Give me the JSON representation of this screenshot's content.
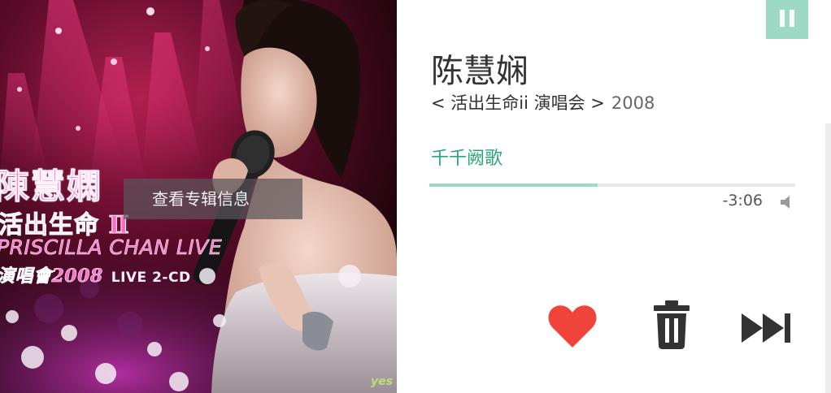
{
  "cover": {
    "artist_text": "陳慧嫻",
    "subtitle_text": "活出生命 Ⅱ",
    "english_text": "PRISCILLA CHAN LIVE",
    "year_text": "演唱會2008",
    "live_text": "LIVE 2-CD",
    "watermark": "yes",
    "album_info_button_label": "查看专辑信息"
  },
  "player": {
    "artist": "陈慧娴",
    "album": "< 活出生命ii 演唱会 >",
    "year": "2008",
    "song": "千千阙歌",
    "time_remaining": "-3:06",
    "progress_fraction": 0.46,
    "is_playing": true
  },
  "controls": {
    "pause_icon": "pause-icon",
    "like_icon": "heart-icon",
    "delete_icon": "trash-icon",
    "next_icon": "skip-next-icon",
    "volume_icon": "volume-icon"
  },
  "colors": {
    "accent": "#9ed9c6",
    "song_title": "#2aa577",
    "like": "#f0433a",
    "controls": "#333333"
  }
}
